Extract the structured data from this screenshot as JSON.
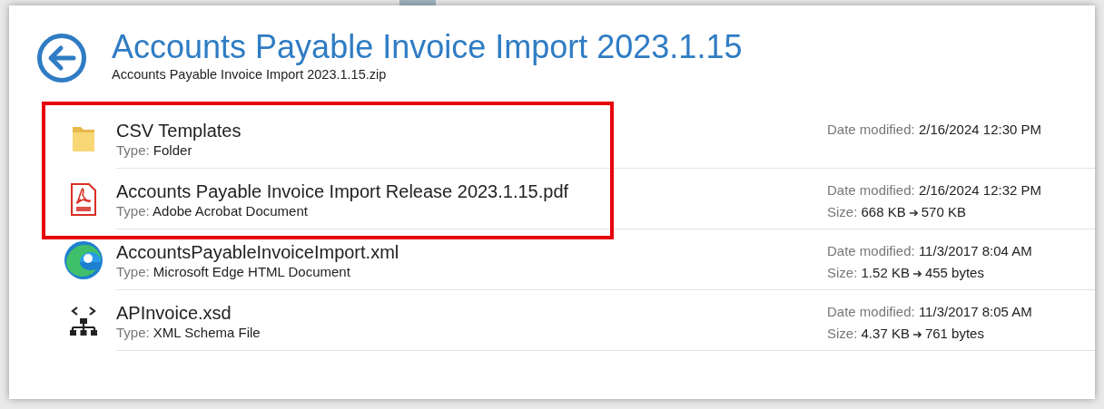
{
  "header": {
    "title": "Accounts Payable Invoice Import 2023.1.15",
    "subtitle": "Accounts Payable Invoice Import 2023.1.15.zip"
  },
  "items": [
    {
      "kind": "folder",
      "name": "CSV Templates",
      "type_label": "Type:",
      "type": "Folder",
      "date_label": "Date modified:",
      "date": "2/16/2024 12:30 PM",
      "highlighted": true
    },
    {
      "kind": "pdf",
      "name": "Accounts Payable Invoice Import Release 2023.1.15.pdf",
      "type_label": "Type:",
      "type": "Adobe Acrobat Document",
      "date_label": "Date modified:",
      "date": "2/16/2024 12:32 PM",
      "size_label": "Size:",
      "size_from": "668 KB",
      "arrow": "➜",
      "size_to": "570 KB",
      "highlighted": true
    },
    {
      "kind": "edge",
      "name": "AccountsPayableInvoiceImport.xml",
      "type_label": "Type:",
      "type": "Microsoft Edge HTML Document",
      "date_label": "Date modified:",
      "date": "11/3/2017 8:04 AM",
      "size_label": "Size:",
      "size_from": "1.52 KB",
      "arrow": "➜",
      "size_to": "455 bytes",
      "highlighted": false
    },
    {
      "kind": "schema",
      "name": "APInvoice.xsd",
      "type_label": "Type:",
      "type": "XML Schema File",
      "date_label": "Date modified:",
      "date": "11/3/2017 8:05 AM",
      "size_label": "Size:",
      "size_from": "4.37 KB",
      "arrow": "➜",
      "size_to": "761 bytes",
      "highlighted": false
    }
  ]
}
